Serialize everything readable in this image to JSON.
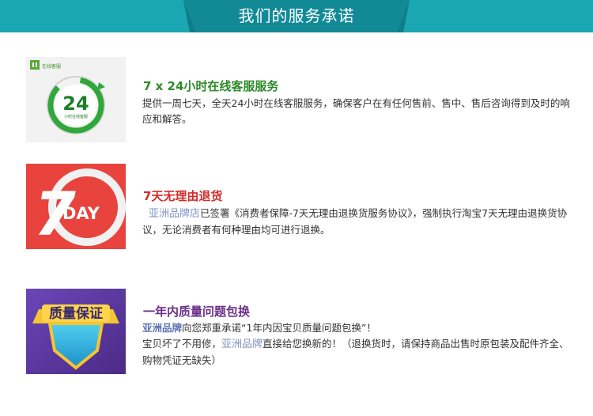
{
  "header": {
    "title": "我们的服务承诺",
    "band_color": "#1aa6b3",
    "tab_color": "#128a96"
  },
  "services": [
    {
      "image_label_logo": "在线客服",
      "image_label_number": "24",
      "image_label_caption": "小时在线客服",
      "title": "7 x 24小时在线客服服务",
      "description": "提供一周七天，全天24小时在线客服服务，确保客户在有任何售前、售中、售后咨询得到及时的响应和解答。",
      "title_color": "#2e8a2a"
    },
    {
      "image_label_number": "7",
      "image_label_word": "DAY",
      "title": "7天无理由退货",
      "brand": "亚洲品牌店",
      "description": "已签署《消费者保障-7天无理由退换货服务协议》，强制执行淘宝7天无理由退换货协议，无论消费者有何种理由均可进行退换。",
      "title_color": "#d42b2b"
    },
    {
      "image_label_badge": "质量保证",
      "title": "一年内质量问题包换",
      "brand": "亚洲品牌",
      "line1": "向您郑重承诺“1年内因宝贝质量问题包换”！",
      "line2_a": "宝贝坏了不用修，",
      "brand2": "亚洲品牌",
      "line2_b": "直接给您换新的！（退换货时，请保持商品出售时原包装及配件齐全、购物凭证无缺失）",
      "title_color": "#6b2f88"
    }
  ]
}
